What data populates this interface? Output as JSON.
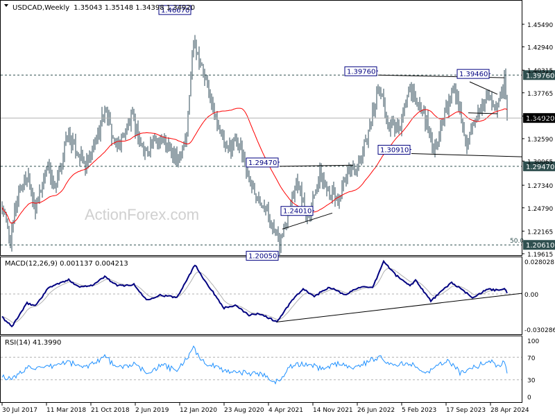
{
  "header": {
    "symbol_timeframe": "USDCAD,Weekly",
    "ohlc": "1.35043 1.35148 1.34398 1.34920"
  },
  "watermark": "ActionForex.com",
  "colors": {
    "bars": "#2c4a57",
    "ma": "#ff0000",
    "macd": "#000080",
    "signal": "#b0b0b0",
    "rsi": "#1e90ff",
    "annotation": "#000080",
    "tag_bg": "#2f4f4f"
  },
  "chart_data": [
    {
      "type": "ohlc-bar",
      "title": "USDCAD,Weekly",
      "ylim": [
        1.19615,
        1.4677
      ],
      "yticks": [
        "1.45490",
        "1.42940",
        "1.40315",
        "1.37765",
        "1.35140",
        "1.32590",
        "1.30065",
        "1.27340",
        "1.24790",
        "1.22165",
        "1.19615"
      ],
      "xticks": [
        "30 Jul 2017",
        "11 Mar 2018",
        "21 Oct 2018",
        "2 Jun 2019",
        "12 Jan 2020",
        "23 Aug 2020",
        "4 Apr 2021",
        "14 Nov 2021",
        "26 Jun 2022",
        "5 Feb 2023",
        "17 Sep 2023",
        "28 Apr 2024"
      ],
      "price_path": [
        [
          "2017-07-30",
          1.25
        ],
        [
          "2017-09-10",
          1.212
        ],
        [
          "2017-10-22",
          1.27
        ],
        [
          "2017-12-10",
          1.285
        ],
        [
          "2018-01-14",
          1.245
        ],
        [
          "2018-03-18",
          1.3
        ],
        [
          "2018-04-22",
          1.265
        ],
        [
          "2018-06-24",
          1.33
        ],
        [
          "2018-09-23",
          1.295
        ],
        [
          "2018-10-28",
          1.31
        ],
        [
          "2018-12-30",
          1.36
        ],
        [
          "2019-02-24",
          1.315
        ],
        [
          "2019-05-19",
          1.35
        ],
        [
          "2019-07-14",
          1.31
        ],
        [
          "2019-10-06",
          1.33
        ],
        [
          "2019-12-29",
          1.3
        ],
        [
          "2020-02-16",
          1.33
        ],
        [
          "2020-03-22",
          1.44
        ],
        [
          "2020-05-10",
          1.4
        ],
        [
          "2020-07-05",
          1.355
        ],
        [
          "2020-09-06",
          1.31
        ],
        [
          "2020-10-25",
          1.33
        ],
        [
          "2021-01-10",
          1.27
        ],
        [
          "2021-03-07",
          1.255
        ],
        [
          "2021-05-30",
          1.206
        ],
        [
          "2021-08-22",
          1.28
        ],
        [
          "2021-10-17",
          1.238
        ],
        [
          "2021-12-19",
          1.285
        ],
        [
          "2022-03-20",
          1.255
        ],
        [
          "2022-05-22",
          1.29
        ],
        [
          "2022-07-10",
          1.3
        ],
        [
          "2022-10-16",
          1.385
        ],
        [
          "2022-11-27",
          1.34
        ],
        [
          "2023-01-22",
          1.335
        ],
        [
          "2023-03-12",
          1.38
        ],
        [
          "2023-05-28",
          1.355
        ],
        [
          "2023-07-16",
          1.315
        ],
        [
          "2023-10-29",
          1.385
        ],
        [
          "2023-12-31",
          1.32
        ],
        [
          "2024-04-14",
          1.375
        ],
        [
          "2024-05-19",
          1.36
        ],
        [
          "2024-06-16",
          1.37
        ],
        [
          "2024-07-07",
          1.3946
        ],
        [
          "2024-07-21",
          1.3492
        ]
      ],
      "ma_period": 40,
      "annotations": [
        {
          "text": "1.46670",
          "price": 1.4667,
          "date": "2020-03-15"
        },
        {
          "text": "1.39760",
          "price": 1.3976,
          "date": "2022-10-09"
        },
        {
          "text": "1.39460",
          "price": 1.3946,
          "date": "2024-04-28"
        },
        {
          "text": "1.30910",
          "price": 1.3091,
          "date": "2023-03-26"
        },
        {
          "text": "1.29470",
          "price": 1.2947,
          "date": "2021-05-30"
        },
        {
          "text": "1.24010",
          "price": 1.2401,
          "date": "2021-11-21"
        },
        {
          "text": "1.20050",
          "price": 1.2005,
          "date": "2021-05-30"
        }
      ],
      "levels": [
        {
          "text": "1.39760",
          "price": 1.3976,
          "style": "dashed"
        },
        {
          "text": "1.34920",
          "price": 1.3492,
          "style": "current"
        },
        {
          "text": "1.29470",
          "price": 1.2947,
          "style": "dashed"
        },
        {
          "text": "1.20610",
          "price": 1.2061,
          "style": "dashed"
        }
      ],
      "fib_label": "50.0"
    },
    {
      "type": "line",
      "title": "MACD(12,26,9) 0.001137 0.004213",
      "ylim": [
        -0.030286,
        0.028028
      ],
      "yticks": [
        "0.028028",
        "0.00",
        "-0.030286"
      ],
      "macd_path": [
        [
          "2017-07-30",
          -0.02
        ],
        [
          "2017-09-17",
          -0.028
        ],
        [
          "2017-12-03",
          -0.008
        ],
        [
          "2018-01-14",
          -0.01
        ],
        [
          "2018-03-25",
          0.006
        ],
        [
          "2018-07-01",
          0.012
        ],
        [
          "2018-08-26",
          0.006
        ],
        [
          "2018-11-04",
          0.008
        ],
        [
          "2018-12-30",
          0.015
        ],
        [
          "2019-03-03",
          0.007
        ],
        [
          "2019-05-26",
          0.008
        ],
        [
          "2019-07-28",
          -0.005
        ],
        [
          "2019-10-06",
          -0.001
        ],
        [
          "2019-12-29",
          -0.003
        ],
        [
          "2020-03-29",
          0.025
        ],
        [
          "2020-05-24",
          0.01
        ],
        [
          "2020-08-23",
          -0.012
        ],
        [
          "2020-10-18",
          -0.01
        ],
        [
          "2020-12-27",
          -0.018
        ],
        [
          "2021-02-21",
          -0.017
        ],
        [
          "2021-05-16",
          -0.024
        ],
        [
          "2021-08-08",
          -0.004
        ],
        [
          "2021-09-26",
          0.004
        ],
        [
          "2021-11-21",
          -0.002
        ],
        [
          "2022-02-06",
          0.006
        ],
        [
          "2022-04-24",
          -0.001
        ],
        [
          "2022-07-03",
          0.006
        ],
        [
          "2022-09-11",
          0.005
        ],
        [
          "2022-11-06",
          0.028
        ],
        [
          "2023-01-08",
          0.016
        ],
        [
          "2023-03-19",
          0.007
        ],
        [
          "2023-04-16",
          0.012
        ],
        [
          "2023-07-02",
          -0.006
        ],
        [
          "2023-10-15",
          0.01
        ],
        [
          "2023-12-10",
          0.003
        ],
        [
          "2024-01-28",
          -0.003
        ],
        [
          "2024-04-14",
          0.004
        ],
        [
          "2024-06-09",
          0.003
        ],
        [
          "2024-07-07",
          0.0045
        ],
        [
          "2024-07-21",
          0.0011
        ]
      ],
      "signal_period": 9
    },
    {
      "type": "line",
      "title": "RSI(14) 41.3990",
      "ylim": [
        0,
        100
      ],
      "yticks": [
        "100",
        "70",
        "30",
        "0"
      ],
      "levels": [
        70,
        30
      ],
      "rsi_path": [
        [
          "2017-07-30",
          38
        ],
        [
          "2017-09-17",
          30
        ],
        [
          "2017-12-17",
          55
        ],
        [
          "2018-02-11",
          48
        ],
        [
          "2018-06-24",
          62
        ],
        [
          "2018-09-16",
          52
        ],
        [
          "2019-01-06",
          72
        ],
        [
          "2019-02-24",
          50
        ],
        [
          "2019-05-19",
          58
        ],
        [
          "2019-07-28",
          43
        ],
        [
          "2019-10-20",
          56
        ],
        [
          "2019-12-29",
          45
        ],
        [
          "2020-03-22",
          85
        ],
        [
          "2020-05-17",
          60
        ],
        [
          "2020-08-23",
          47
        ],
        [
          "2020-12-13",
          42
        ],
        [
          "2021-03-07",
          40
        ],
        [
          "2021-05-23",
          25
        ],
        [
          "2021-07-18",
          54
        ],
        [
          "2021-10-17",
          58
        ],
        [
          "2021-12-26",
          50
        ],
        [
          "2022-03-20",
          58
        ],
        [
          "2022-06-19",
          52
        ],
        [
          "2022-10-16",
          72
        ],
        [
          "2022-12-25",
          55
        ],
        [
          "2023-03-19",
          60
        ],
        [
          "2023-06-11",
          44
        ],
        [
          "2023-10-01",
          64
        ],
        [
          "2023-11-26",
          43
        ],
        [
          "2024-02-18",
          54
        ],
        [
          "2024-04-21",
          63
        ],
        [
          "2024-06-09",
          55
        ],
        [
          "2024-07-07",
          63
        ],
        [
          "2024-07-21",
          41.4
        ]
      ]
    }
  ]
}
